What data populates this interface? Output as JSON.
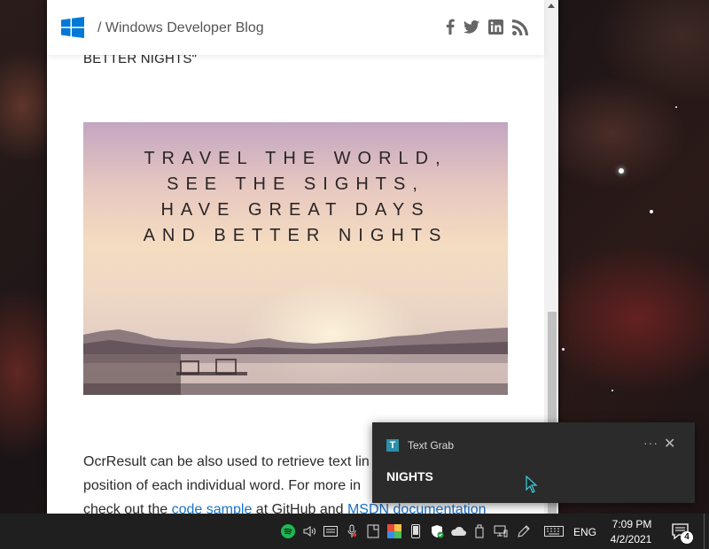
{
  "site": {
    "breadcrumb": "/ Windows Developer Blog",
    "social_icons": [
      "facebook-icon",
      "twitter-icon",
      "linkedin-icon",
      "rss-icon"
    ]
  },
  "article": {
    "cut_heading": "BETTER NIGHTS\"",
    "hero_lines": [
      "TRAVEL THE WORLD,",
      "SEE THE SIGHTS,",
      "HAVE GREAT DAYS",
      "AND BETTER NIGHTS"
    ],
    "para_line1": "OcrResult can be also used to retrieve text lin",
    "para_line2": "position of each individual word. For more in",
    "para_line3_prefix": "check out the ",
    "link_code_sample": "code sample",
    "para_line3_mid": " at GitHub and ",
    "link_msdn": "MSDN documentation"
  },
  "toast": {
    "app_name": "Text Grab",
    "more_label": "···",
    "close_label": "✕",
    "text": "NIGHTS"
  },
  "taskbar": {
    "tray_icons": [
      "spotify-icon",
      "volume-icon",
      "keyboard-switch-icon",
      "microphone-icon",
      "notes-icon",
      "color-picker-icon",
      "phone-icon",
      "security-shield-icon",
      "onedrive-icon",
      "usb-drive-icon",
      "network-icon",
      "pen-icon",
      "touch-keyboard-icon"
    ],
    "language": "ENG",
    "time": "7:09 PM",
    "date": "4/2/2021",
    "notification_count": "4"
  },
  "colors": {
    "link": "#1a73c7",
    "toast_bg": "#2b2b2b",
    "taskbar_bg": "#1f1f1f",
    "windows_blue": "#0078d7"
  }
}
